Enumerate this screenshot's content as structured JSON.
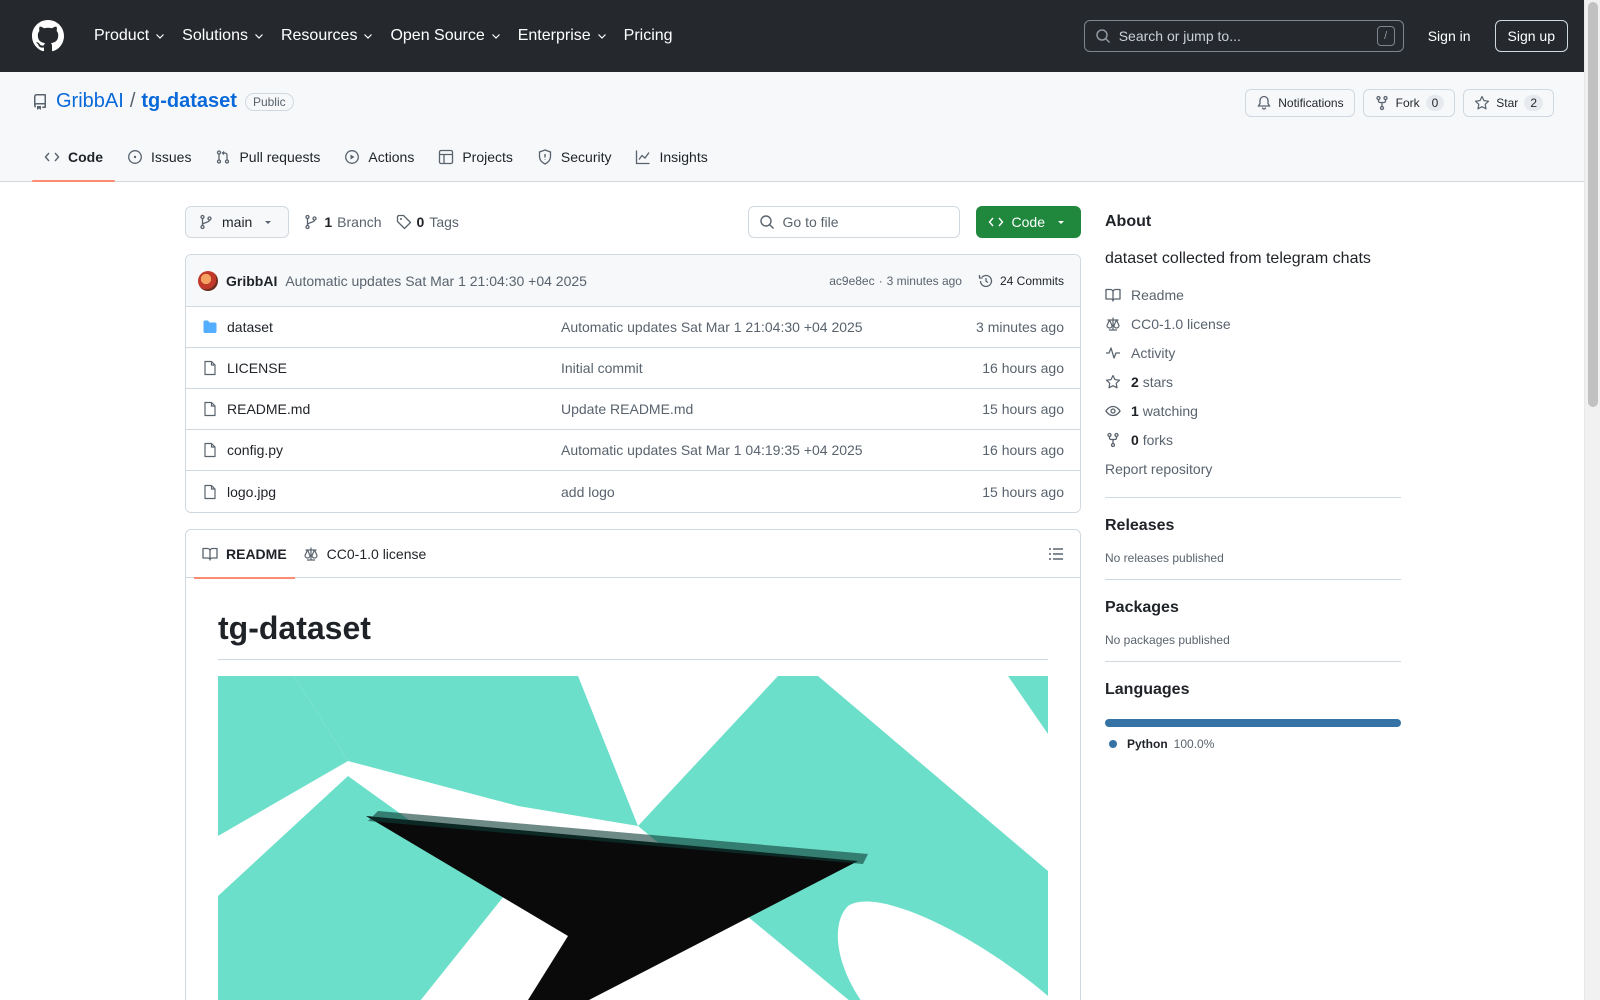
{
  "header": {
    "nav": [
      "Product",
      "Solutions",
      "Resources",
      "Open Source",
      "Enterprise",
      "Pricing"
    ],
    "search_placeholder": "Search or jump to...",
    "search_shortcut": "/",
    "sign_in": "Sign in",
    "sign_up": "Sign up"
  },
  "repo": {
    "owner": "GribbAI",
    "separator": "/",
    "name": "tg-dataset",
    "visibility": "Public",
    "notifications_label": "Notifications",
    "fork_label": "Fork",
    "fork_count": "0",
    "star_label": "Star",
    "star_count": "2"
  },
  "tabs": [
    "Code",
    "Issues",
    "Pull requests",
    "Actions",
    "Projects",
    "Security",
    "Insights"
  ],
  "toolbar": {
    "branch": "main",
    "branch_count": "1",
    "branch_label": "Branch",
    "tag_count": "0",
    "tag_label": "Tags",
    "goto_placeholder": "Go to file",
    "code_label": "Code"
  },
  "commit": {
    "author": "GribbAI",
    "message": "Automatic updates Sat Mar 1 21:04:30 +04 2025",
    "hash": "ac9e8ec",
    "dot": "·",
    "time": "3 minutes ago",
    "count_label": "24 Commits"
  },
  "files": [
    {
      "name": "dataset",
      "type": "folder",
      "message": "Automatic updates Sat Mar 1 21:04:30 +04 2025",
      "time": "3 minutes ago"
    },
    {
      "name": "LICENSE",
      "type": "file",
      "message": "Initial commit",
      "time": "16 hours ago"
    },
    {
      "name": "README.md",
      "type": "file",
      "message": "Update README.md",
      "time": "15 hours ago"
    },
    {
      "name": "config.py",
      "type": "file",
      "message": "Automatic updates Sat Mar 1 04:19:35 +04 2025",
      "time": "16 hours ago"
    },
    {
      "name": "logo.jpg",
      "type": "file",
      "message": "add logo",
      "time": "15 hours ago"
    }
  ],
  "readme": {
    "tab_readme": "README",
    "tab_license": "CC0-1.0 license",
    "heading": "tg-dataset"
  },
  "sidebar": {
    "about_title": "About",
    "description": "dataset collected from telegram chats",
    "readme": "Readme",
    "license": "CC0-1.0 license",
    "activity": "Activity",
    "stars_count": "2",
    "stars_label": "stars",
    "watching_count": "1",
    "watching_label": "watching",
    "forks_count": "0",
    "forks_label": "forks",
    "report": "Report repository",
    "releases_title": "Releases",
    "releases_sub": "No releases published",
    "packages_title": "Packages",
    "packages_sub": "No packages published",
    "languages_title": "Languages",
    "language_name": "Python",
    "language_pct": "100.0%"
  },
  "colors": {
    "accent_green": "#1f883d",
    "link_blue": "#0969da",
    "python": "#3572a5",
    "tab_underline": "#fd8c73",
    "logo_teal": "#6cdfca"
  }
}
